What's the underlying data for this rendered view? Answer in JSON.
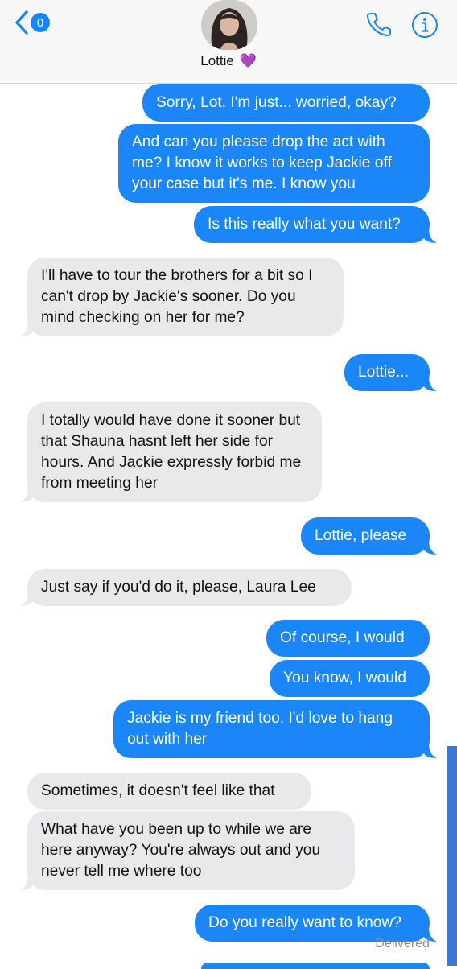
{
  "header": {
    "back_badge": "0",
    "contact_name": "Lottie",
    "contact_emoji": "💜",
    "icons": [
      "back-chevron-icon",
      "phone-icon",
      "info-icon"
    ]
  },
  "messages": [
    {
      "side": "sent",
      "text": "Sorry, Lot. I'm just... worried, okay?"
    },
    {
      "side": "sent",
      "text": "And can you please drop the act with me? I know it works to keep Jackie off your case but it's me. I know you"
    },
    {
      "side": "sent",
      "text": "Is this really what you want?"
    },
    {
      "side": "received",
      "text": "I'll have to tour the brothers for a bit so I can't drop by Jackie's sooner. Do you mind checking on her for me?"
    },
    {
      "side": "sent",
      "text": "Lottie..."
    },
    {
      "side": "received",
      "text": "I totally would have done it sooner but that Shauna hasnt left her side for hours. And Jackie expressly forbid me from meeting her"
    },
    {
      "side": "sent",
      "text": "Lottie, please"
    },
    {
      "side": "received",
      "text": "Just say if you'd do it, please, Laura Lee"
    },
    {
      "side": "sent",
      "text": "Of course, I would"
    },
    {
      "side": "sent",
      "text": "You know, I would"
    },
    {
      "side": "sent",
      "text": "Jackie is my friend too. I'd love to hang out with her"
    },
    {
      "side": "received",
      "text": "Sometimes, it doesn't feel like that"
    },
    {
      "side": "received",
      "text": "What have you been up to while we are here anyway? You're always out and you never tell me where too"
    },
    {
      "side": "sent",
      "text": "Do you really want to know?"
    }
  ],
  "status": {
    "delivered": "Delivered"
  },
  "colors": {
    "sent": "#1b86f8",
    "received": "#e9e9eb",
    "accent": "#1685f7"
  }
}
